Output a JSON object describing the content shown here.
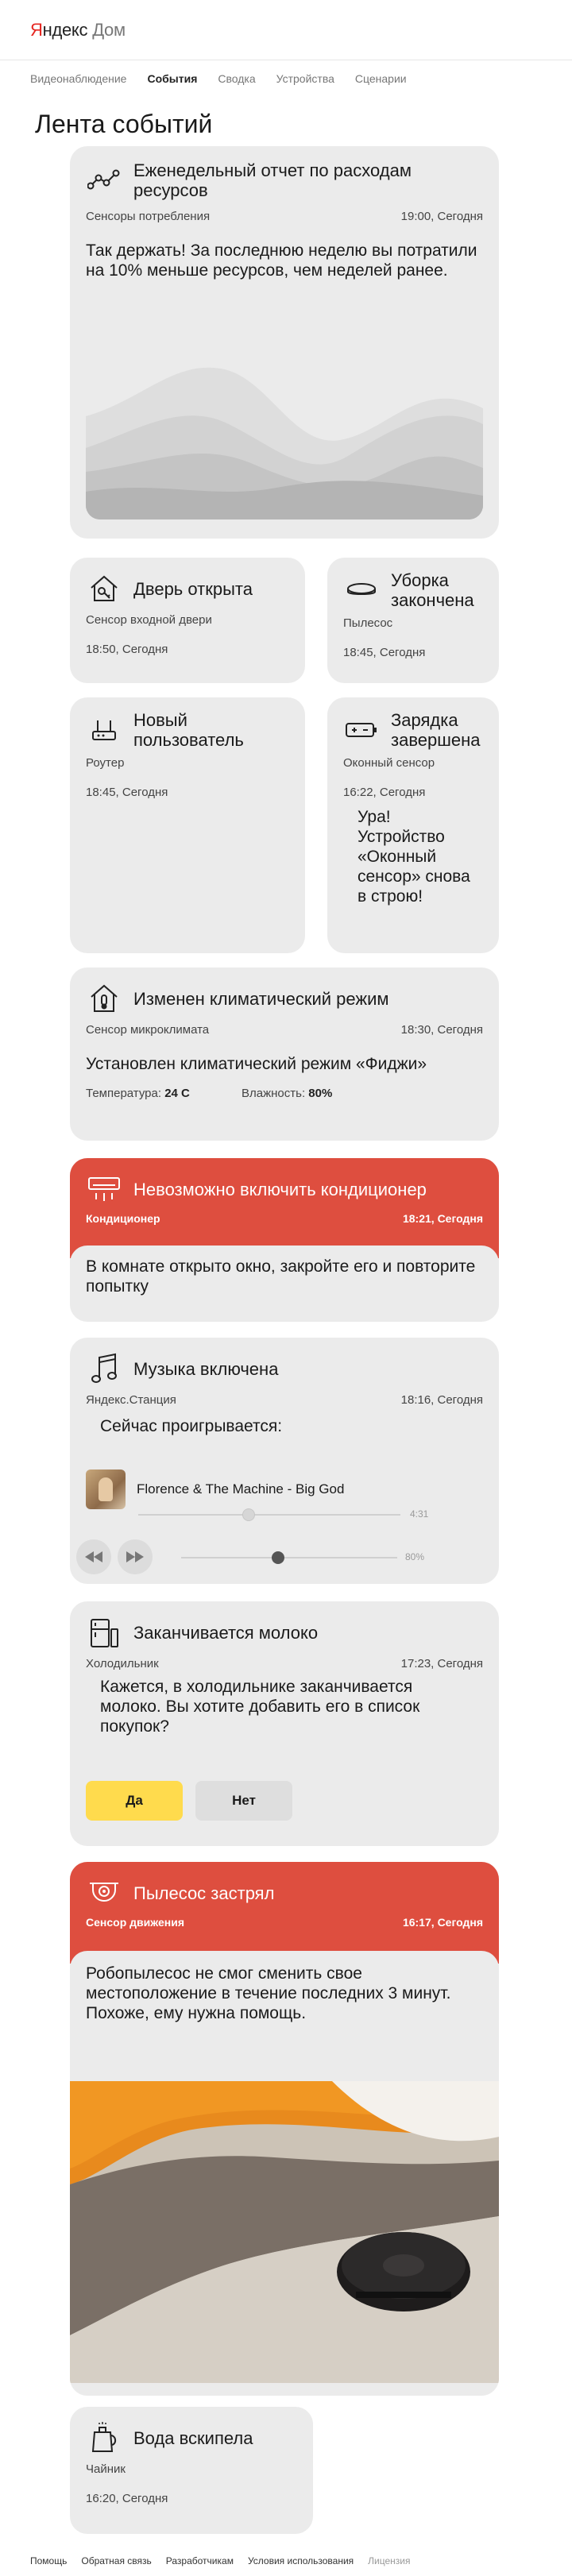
{
  "header": {
    "logo_y": "Я",
    "logo_rest": "ндекс",
    "logo_dom": "Дом"
  },
  "nav": [
    "Видеонаблюдение",
    "События",
    "Сводка",
    "Устройства",
    "Сценарии"
  ],
  "nav_active": "События",
  "page_title": "Лента событий",
  "cards": {
    "report": {
      "icon": "chart-line-icon",
      "title": "Еженедельный отчет по расходам ресурсов",
      "source": "Сенсоры потребления",
      "time": "19:00, Сегодня",
      "text": "Так держать! За последнюю неделю вы потратили на 10% меньше ресурсов, чем неделей ранее."
    },
    "door": {
      "icon": "house-key-icon",
      "title": "Дверь открыта",
      "source": "Сенсор входной двери",
      "time": "18:50, Сегодня"
    },
    "cleaning": {
      "icon": "robot-vacuum-icon",
      "title": "Уборка закончена",
      "source": "Пылесос",
      "time": "18:45, Сегодня"
    },
    "new_user": {
      "icon": "router-icon",
      "title": "Новый пользователь",
      "source": "Роутер",
      "time": "18:45, Сегодня"
    },
    "charging": {
      "icon": "battery-icon",
      "title": "Зарядка завершена",
      "source": "Оконный сенсор",
      "time": "16:22, Сегодня",
      "text": "Ура! Устройство «Оконный сенсор» снова в строю!"
    },
    "climate": {
      "icon": "house-thermometer-icon",
      "title": "Изменен климатический режим",
      "source": "Сенсор микроклимата",
      "time": "18:30, Сегодня",
      "text": "Установлен климатический режим «Фиджи»",
      "temp_label": "Температура:",
      "temp_value": "24 C",
      "humidity_label": "Влажность:",
      "humidity_value": "80%"
    },
    "ac": {
      "icon": "air-conditioner-icon",
      "title": "Невозможно включить кондиционер",
      "source": "Кондиционер",
      "time": "18:21, Сегодня",
      "text": "В комнате открыто окно, закройте его и повторите попытку"
    },
    "music": {
      "icon": "music-note-icon",
      "title": "Музыка включена",
      "source": "Яндекс.Станция",
      "time": "18:16, Сегодня",
      "now_playing": "Сейчас проигрывается:",
      "track": "Florence & The Machine - Big God",
      "remaining": "4:31",
      "volume": "80%",
      "progress_fraction": 0.42,
      "volume_fraction": 0.45
    },
    "milk": {
      "icon": "fridge-icon",
      "title": "Заканчивается молоко",
      "source": "Холодильник",
      "time": "17:23, Сегодня",
      "text": "Кажется, в холодильнике заканчивается молоко. Вы хотите добавить его в список покупок?",
      "yes": "Да",
      "no": "Нет"
    },
    "stuck": {
      "icon": "camera-sensor-icon",
      "title": "Пылесос застрял",
      "source": "Сенсор движения",
      "time": "16:17, Сегодня",
      "text": "Робопылесос не смог сменить свое местоположение в течение последних 3 минут. Похоже, ему нужна помощь."
    },
    "kettle": {
      "icon": "kettle-icon",
      "title": "Вода вскипела",
      "source": "Чайник",
      "time": "16:20, Сегодня"
    }
  },
  "footer": [
    "Помощь",
    "Обратная связь",
    "Разработчикам",
    "Условия использования"
  ],
  "footer_muted": "Лицензия",
  "colors": {
    "alert": "#de4e3f",
    "accent_yellow": "#ffdb4d",
    "card_bg": "#ebebeb"
  }
}
